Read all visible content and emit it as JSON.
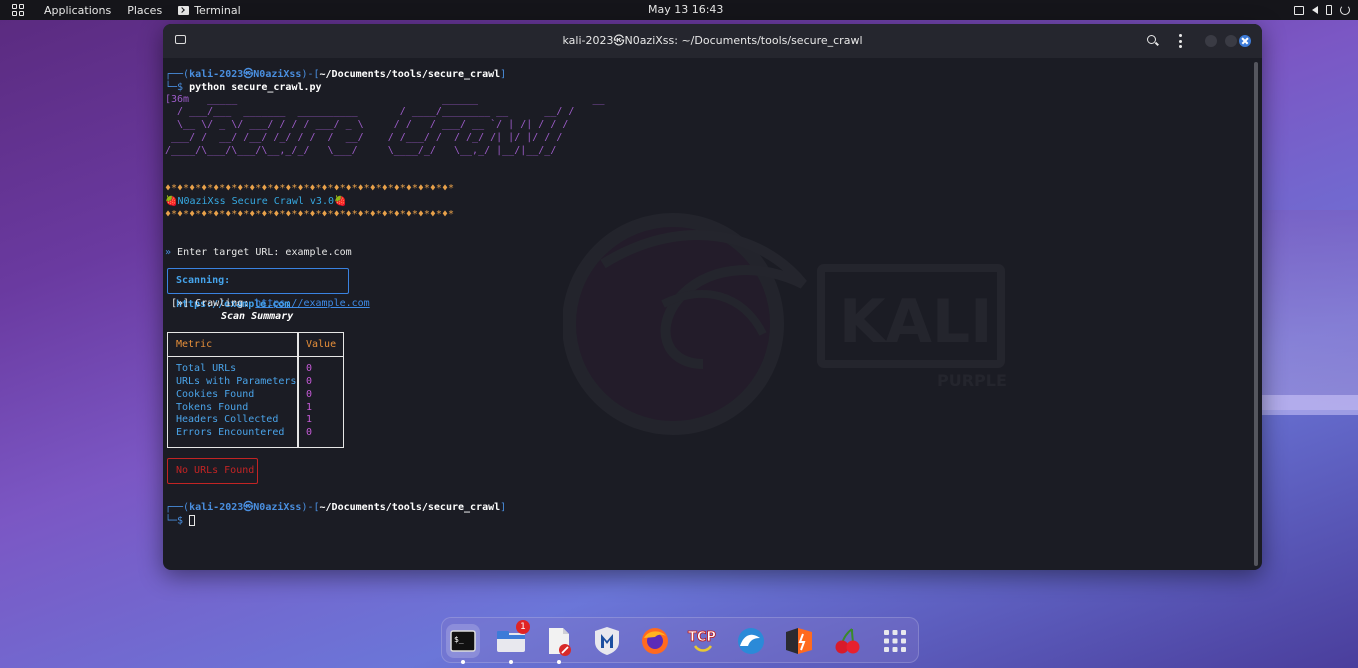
{
  "top_panel": {
    "applications": "Applications",
    "places": "Places",
    "terminal": "Terminal",
    "clock": "May 13  16:43"
  },
  "window": {
    "title": "kali-2023㉿N0aziXss: ~/Documents/tools/secure_crawl"
  },
  "terminal": {
    "prompt1": {
      "pre": "┌──(",
      "user": "kali-2023㉿N0aziXss",
      "mid": ")-[",
      "path": "~/Documents/tools/secure_crawl",
      "post": "]"
    },
    "cmd_prefix": "└─$ ",
    "command": "python secure_crawl.py",
    "ansi_residue": "[36m",
    "ascii_art": [
      "[36m   _____                                  ______                   __",
      "  / ___/___  _______  __________       / ____/________ __      __/ /",
      "  \\__ \\/ _ \\/ ___/ / / / ___/ _ \\     / /   / ___/ __ `/ | /| / / / ",
      " ___/ /  __/ /__/ /_/ / /  /  __/    / /___/ /  / /_/ /| |/ |/ / /  ",
      "/____/\\___/\\___/\\__,_/_/   \\___/     \\____/_/   \\__,_/ |__/|__/_/   "
    ],
    "stars": "♦*♦*♦*♦*♦*♦*♦*♦*♦*♦*♦*♦*♦*♦*♦*♦*♦*♦*♦*♦*♦*♦*♦*♦*",
    "banner": "🍓N0aziXss Secure Crawl v3.0🍓",
    "input_marker": "» ",
    "input_label": "Enter target URL: ",
    "input_value": "example.com",
    "scanning": "Scanning: https://example.com",
    "crawl_prefix": "[»] Crawling: ",
    "crawl_url": "https://example.com",
    "summary_title": "Scan Summary",
    "table": {
      "headers": [
        "Metric",
        "Value"
      ],
      "rows": [
        {
          "metric": "Total URLs",
          "value": "0"
        },
        {
          "metric": "URLs with Parameters",
          "value": "0"
        },
        {
          "metric": "Cookies Found",
          "value": "0"
        },
        {
          "metric": "Tokens Found",
          "value": "1"
        },
        {
          "metric": "Headers Collected",
          "value": "1"
        },
        {
          "metric": "Errors Encountered",
          "value": "0"
        }
      ]
    },
    "error": "No URLs Found",
    "prompt2": {
      "pre": "┌──(",
      "user": "kali-2023㉿N0aziXss",
      "mid": ")-[",
      "path": "~/Documents/tools/secure_crawl",
      "post": "]"
    },
    "cmd_prefix2": "└─$ "
  },
  "watermark": {
    "brand": "KALI",
    "sub": "PURPLE"
  },
  "dock": {
    "files_badge": "1",
    "tcp_label": "TCP"
  },
  "colors": {
    "prompt_blue": "#4a8fe0",
    "ascii_purple": "#9c5cc8",
    "error_red": "#c22424",
    "accent_close": "#3d7bd8"
  }
}
